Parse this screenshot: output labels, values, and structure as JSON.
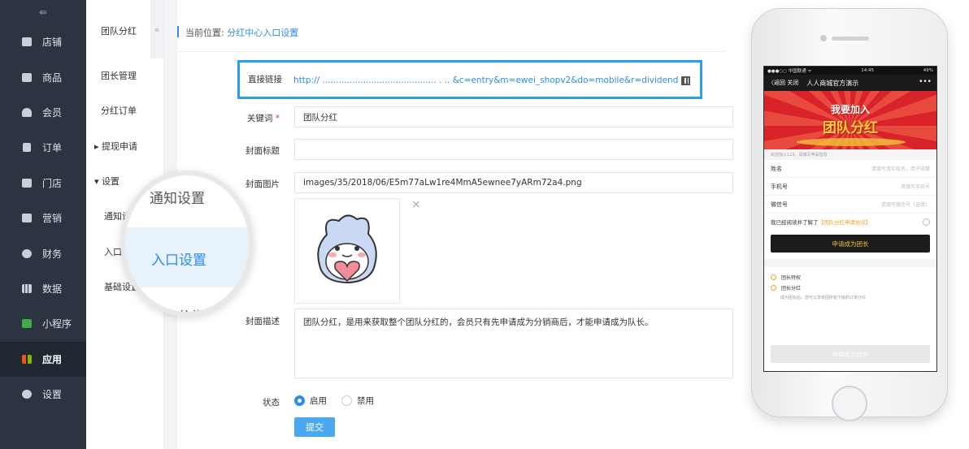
{
  "sidebar": {
    "toggle": "⇚",
    "items": [
      {
        "label": "店铺"
      },
      {
        "label": "商品"
      },
      {
        "label": "会员"
      },
      {
        "label": "订单"
      },
      {
        "label": "门店"
      },
      {
        "label": "营销"
      },
      {
        "label": "财务"
      },
      {
        "label": "数据"
      },
      {
        "label": "小程序"
      },
      {
        "label": "应用"
      },
      {
        "label": "设置"
      }
    ],
    "active": "应用"
  },
  "subnav": {
    "title": "团队分红",
    "collapse": "«",
    "items": [
      "团长管理",
      "分红订单",
      "提现申请",
      "设置",
      "通知设置",
      "入口设置",
      "基础设置"
    ]
  },
  "breadcrumb": {
    "prefix": "当前位置:",
    "current": "分红中心入口设置"
  },
  "form": {
    "link_label": "直接链接",
    "link_url": "http://  ..........................................   .   ..   &c=entry&m=ewei_shopv2&do=mobile&r=dividend",
    "keyword_label": "关键词",
    "keyword_required": "*",
    "keyword_value": "团队分红",
    "cover_title_label": "封面标题",
    "cover_title_value": "",
    "cover_image_label": "封面图片",
    "cover_image_value": "images/35/2018/06/E5m77aLw1re4MmA5ewnee7yARm72a4.png",
    "remove_image": "×",
    "cover_desc_label": "封面描述",
    "cover_desc_value": "团队分红，是用来获取整个团队分红的，会员只有先申请成为分销商后，才能申请成为队长。",
    "status_label": "状态",
    "status_on": "启用",
    "status_off": "禁用",
    "submit": "提交"
  },
  "magnifier": {
    "top": "通知设置",
    "mid": "入口设置",
    "bottom": "分红分类"
  },
  "phone": {
    "status_left": "●●●○○ 中国联通 ᯤ",
    "status_time": "14:45",
    "status_right": "49%",
    "back": "〈返回  关闭",
    "title": "人人商城官方演示",
    "menu": "•••",
    "banner_line1": "我要加入",
    "banner_line2": "团队分红",
    "hint": "欢迎加入123，请填写申请信息",
    "fields": [
      {
        "label": "姓名",
        "placeholder": "请填写真实姓名，用于结算"
      },
      {
        "label": "手机号",
        "placeholder": "请填写手机号"
      },
      {
        "label": "微信号",
        "placeholder": "请填写微信号（选填）"
      }
    ],
    "agree_prefix": "我已经阅读并了解了",
    "agree_link": "【团队分红申请协议】",
    "apply_btn": "申请成为团长",
    "privilege_title": "团长特权",
    "privilege_item": "团长分红",
    "privilege_desc": "成为团长后，您可以享受团所有下级的订单分红",
    "bottom_btn": "申请成为团长"
  }
}
